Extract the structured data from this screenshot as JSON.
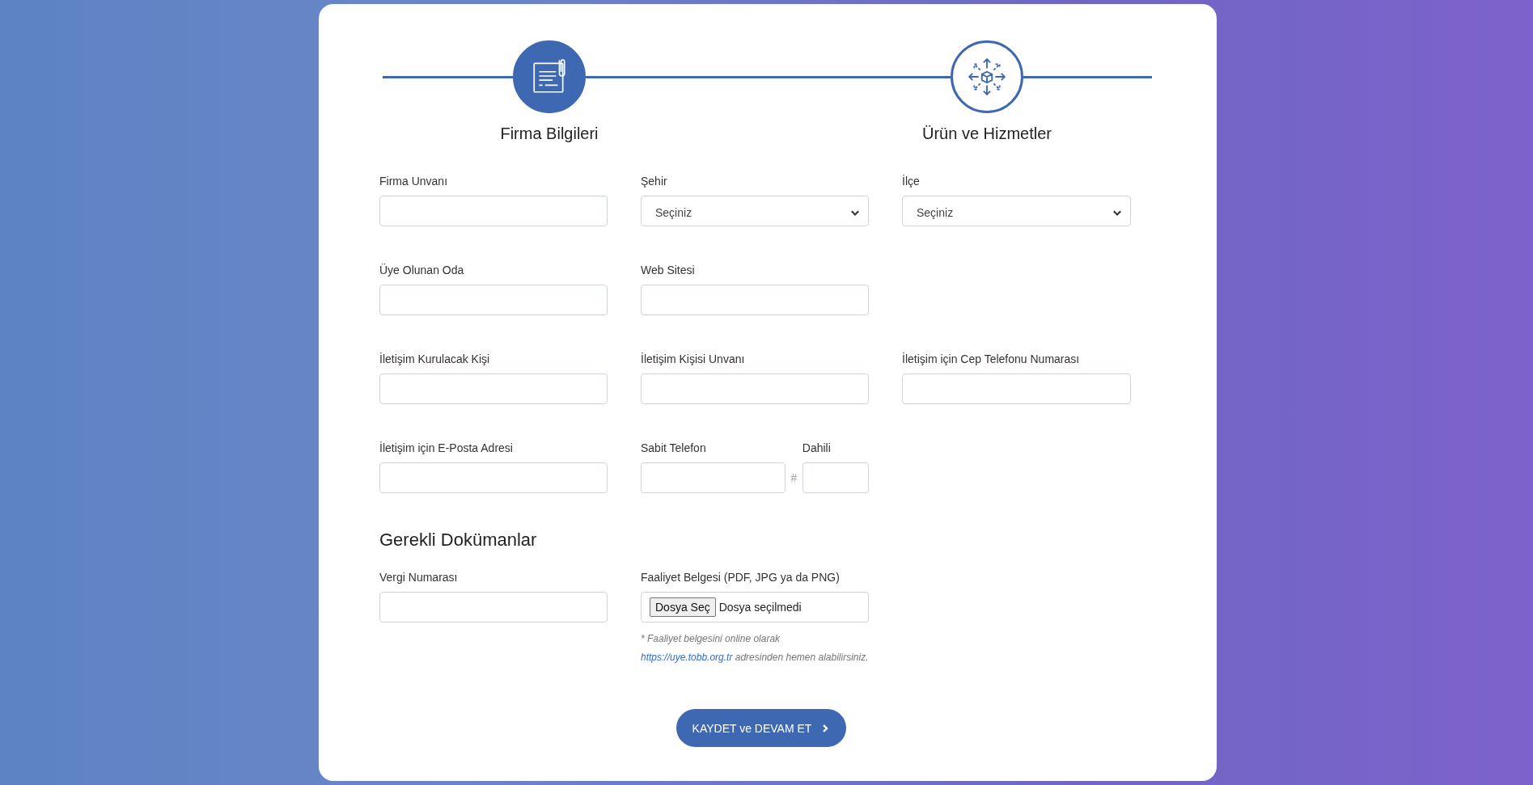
{
  "steps": [
    {
      "label": "Firma Bilgileri",
      "kind": "document",
      "selected": true
    },
    {
      "label": "Ürün ve Hizmetler",
      "kind": "products",
      "selected": false
    }
  ],
  "form_rows": [
    [
      {
        "kind": "text",
        "label": "Firma Unvanı"
      },
      {
        "kind": "select",
        "label": "Şehir",
        "value": "Seçiniz"
      },
      {
        "kind": "select",
        "label": "İlçe",
        "value": "Seçiniz"
      }
    ],
    [
      {
        "kind": "text",
        "label": "Üye Olunan Oda"
      },
      {
        "kind": "text",
        "label": "Web Sitesi"
      }
    ],
    [
      {
        "kind": "text",
        "label": "İletişim Kurulacak Kişi"
      },
      {
        "kind": "text",
        "label": "İletişim Kişisi Unvanı"
      },
      {
        "kind": "text",
        "label": "İletişim için Cep Telefonu Numarası"
      }
    ],
    [
      {
        "kind": "text",
        "label": "İletişim için E-Posta Adresi"
      },
      {
        "kind": "phone",
        "label": "Sabit Telefon",
        "ext_label": "Dahili",
        "separator": "#"
      }
    ]
  ],
  "documents": {
    "title": "Gerekli Dokümanlar",
    "fields": [
      {
        "kind": "text",
        "label": "Vergi Numarası"
      },
      {
        "kind": "file",
        "label": "Faaliyet Belgesi (PDF, JPG ya da PNG)",
        "button": "Dosya Seç",
        "status": "Dosya seçilmedi",
        "note": "* Faaliyet belgesini online olarak",
        "link": "https://uye.tobb.org.tr",
        "note_after": " adresinden hemen alabilirsiniz."
      }
    ]
  },
  "submit": {
    "label": "KAYDET ve DEVAM ET"
  }
}
